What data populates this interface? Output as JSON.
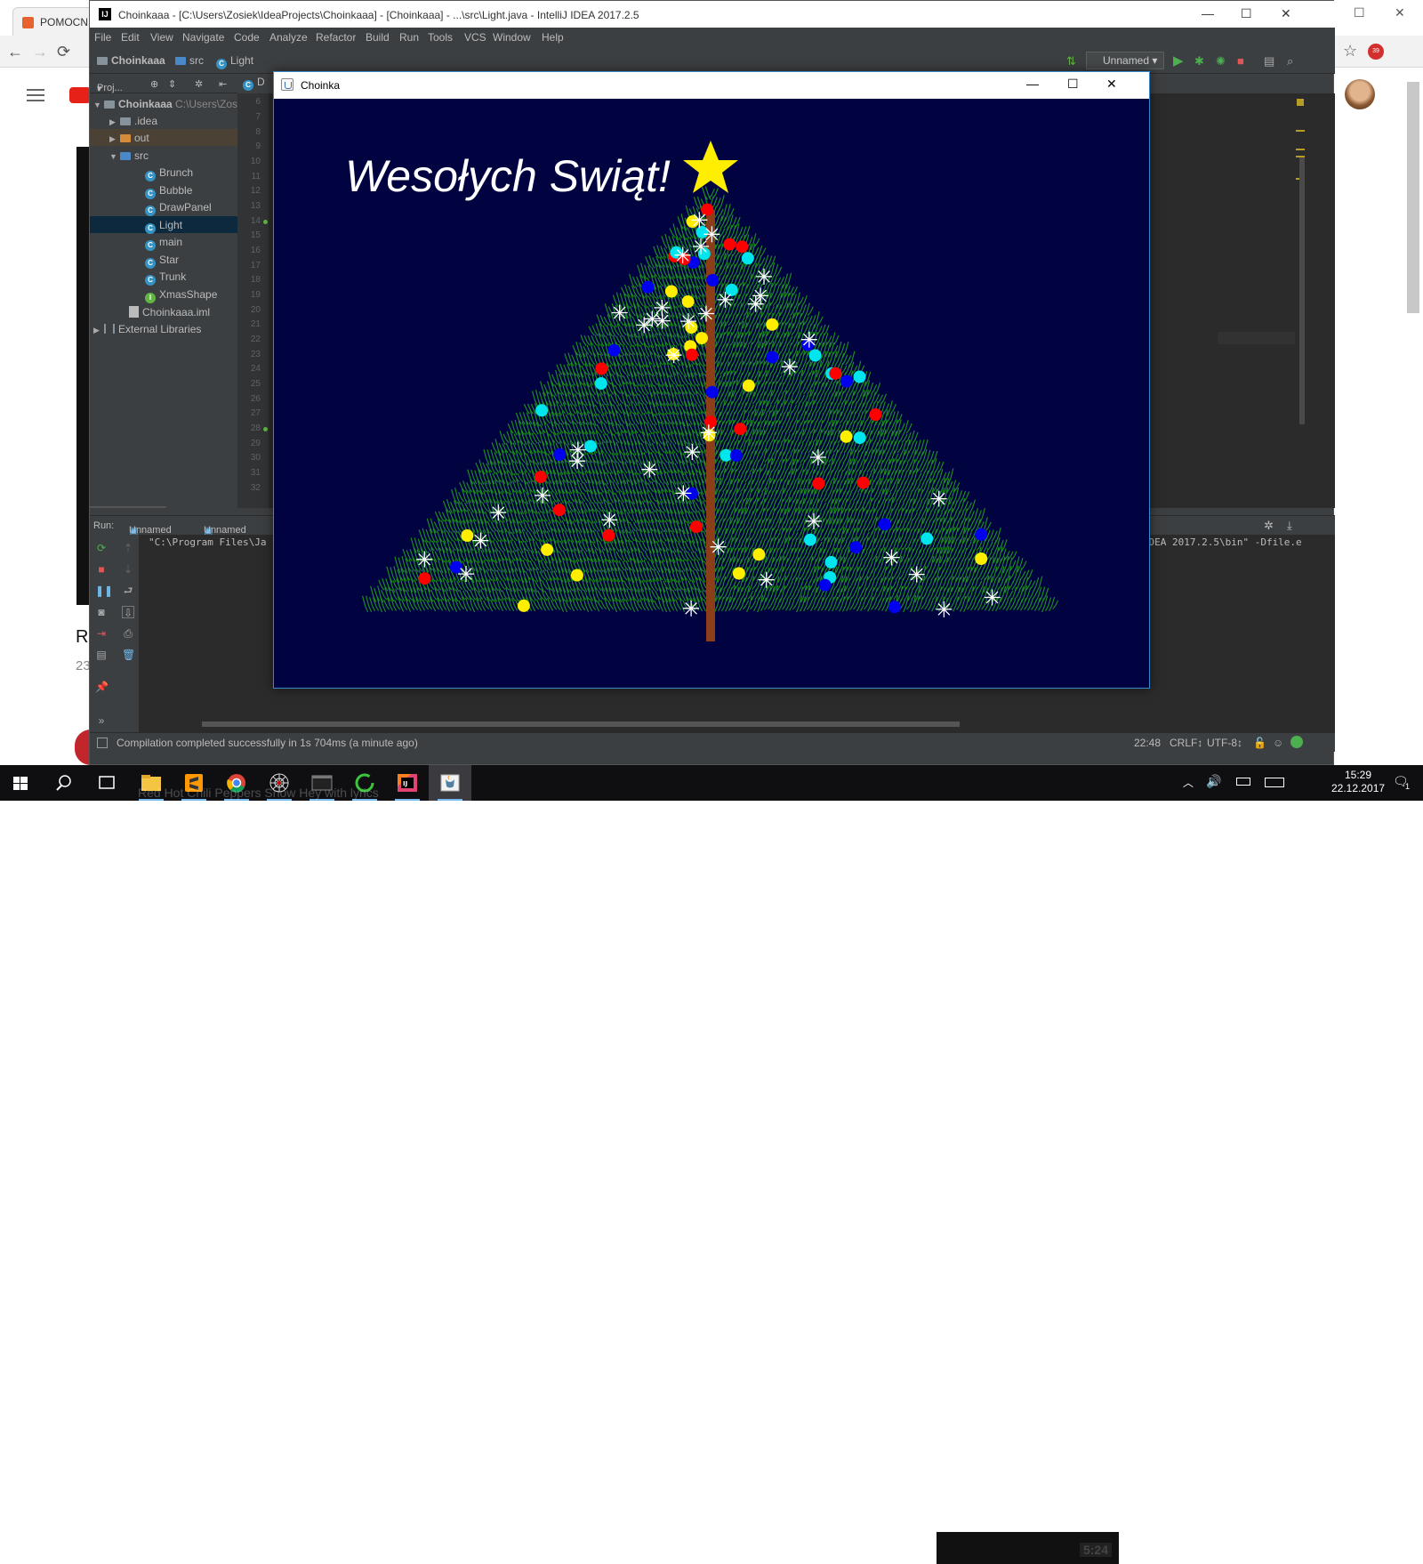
{
  "browser": {
    "tab_title": "POMOCNI",
    "nav": {
      "back": "←",
      "forward": "→",
      "reload": "⟳"
    },
    "window_controls": {
      "minimize": "—",
      "maximize": "☐",
      "close": "✕"
    },
    "bookmark_star": "☆",
    "extension_badge": "39",
    "page_title_fragment": "R",
    "page_meta_fragment": "23",
    "ghost_text": "Red Hot Chili Peppers Snow Hey with lyrics"
  },
  "ide": {
    "title": "Choinkaaa - [C:\\Users\\Zosiek\\IdeaProjects\\Choinkaaa] - [Choinkaaa] - ...\\src\\Light.java - IntelliJ IDEA 2017.2.5",
    "title_icon": "IJ",
    "window_controls": {
      "minimize": "—",
      "maximize": "☐",
      "close": "✕"
    },
    "menu": [
      "File",
      "Edit",
      "View",
      "Navigate",
      "Code",
      "Analyze",
      "Refactor",
      "Build",
      "Run",
      "Tools",
      "VCS",
      "Window",
      "Help"
    ],
    "breadcrumb": [
      "Choinkaaa",
      "src",
      "Light"
    ],
    "run_config": "Unnamed",
    "editor_tab_fragment": "D",
    "project_header": {
      "label": "Proj...",
      "dropdown": "▾"
    },
    "tree": [
      {
        "label": "Choinkaaa",
        "path": "C:\\Users\\Zos",
        "depth": 0,
        "kind": "module",
        "expanded": true
      },
      {
        "label": ".idea",
        "depth": 1,
        "kind": "folder",
        "expanded": false
      },
      {
        "label": "out",
        "depth": 1,
        "kind": "folder-orange",
        "expanded": false
      },
      {
        "label": "src",
        "depth": 1,
        "kind": "folder-blue",
        "expanded": true
      },
      {
        "label": "Brunch",
        "depth": 2,
        "kind": "class"
      },
      {
        "label": "Bubble",
        "depth": 2,
        "kind": "class"
      },
      {
        "label": "DrawPanel",
        "depth": 2,
        "kind": "class"
      },
      {
        "label": "Light",
        "depth": 2,
        "kind": "class",
        "selected": true
      },
      {
        "label": "main",
        "depth": 2,
        "kind": "class"
      },
      {
        "label": "Star",
        "depth": 2,
        "kind": "class"
      },
      {
        "label": "Trunk",
        "depth": 2,
        "kind": "class"
      },
      {
        "label": "XmasShape",
        "depth": 2,
        "kind": "interface"
      },
      {
        "label": "Choinkaaa.iml",
        "depth": 1,
        "kind": "iml"
      },
      {
        "label": "External Libraries",
        "depth": 0,
        "kind": "library",
        "expanded": false
      }
    ],
    "line_numbers": [
      "6",
      "7",
      "8",
      "9",
      "10",
      "11",
      "12",
      "13",
      "14",
      "15",
      "16",
      "17",
      "18",
      "19",
      "20",
      "21",
      "22",
      "23",
      "24",
      "25",
      "26",
      "27",
      "28",
      "29",
      "30",
      "31",
      "32"
    ],
    "run_panel": {
      "label": "Run:",
      "tabs": [
        "Unnamed",
        "Unnamed"
      ],
      "console_line": "\"C:\\Program Files\\Ja",
      "console_right": "iJ IDEA 2017.2.5\\bin\" -Dfile.e"
    },
    "status": {
      "message": "Compilation completed successfully in 1s 704ms (a minute ago)",
      "position": "22:48",
      "line_sep": "CRLF↕",
      "encoding": "UTF-8↕"
    }
  },
  "app": {
    "title": "Choinka",
    "window_controls": {
      "minimize": "—",
      "maximize": "☐",
      "close": "✕"
    },
    "greeting": "Wesołych Swiąt!",
    "colors": {
      "background": "#000340",
      "needles": "#1f8a1f",
      "trunk": "#8b3e17",
      "star": "#ffee00",
      "ornament_red": "#ff0000",
      "ornament_yellow": "#ffee00",
      "ornament_cyan": "#00e5ee",
      "ornament_blue": "#0000ee",
      "sparkle": "#ffffff"
    }
  },
  "taskbar": {
    "apps": [
      "start",
      "search",
      "task-view",
      "file-explorer",
      "sublime-text",
      "chrome",
      "spider-app",
      "terminal",
      "refresh-app",
      "intellij",
      "java-app"
    ],
    "active": "java-app",
    "time": "15:29",
    "date": "22.12.2017",
    "thumbnail_time": "5:24",
    "notifications": "1"
  }
}
